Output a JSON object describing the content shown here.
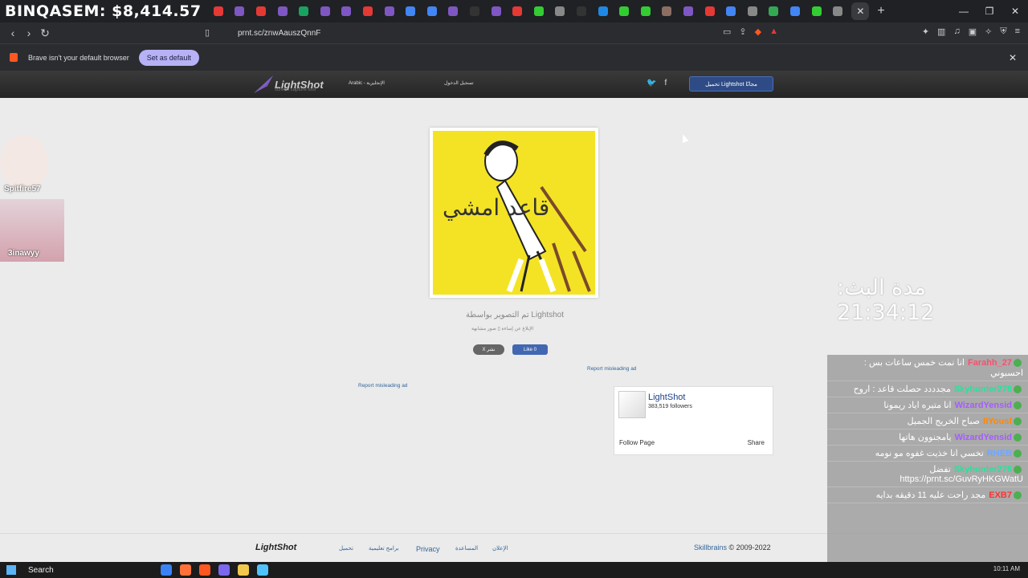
{
  "browser": {
    "tab_title": "BINQASEM: $8,414.57",
    "tab_icon_colors": [
      "#e53935",
      "#7e57c2",
      "#e53935",
      "#7e57c2",
      "#1aa260",
      "#7e57c2",
      "#7e57c2",
      "#e53935",
      "#7e57c2",
      "#4285f4",
      "#4285f4",
      "#7e57c2",
      "#333333",
      "#7e57c2",
      "#e53935",
      "#33cc33",
      "#888888",
      "#333333",
      "#1e88e5",
      "#33cc33",
      "#33cc33",
      "#8d6e63",
      "#7e57c2",
      "#e53935",
      "#4285f4",
      "#888888",
      "#34a853",
      "#4285f4",
      "#33cc33",
      "#888888"
    ],
    "active_tab_close": "✕",
    "new_tab": "+",
    "window_controls": [
      "—",
      "❐",
      "✕"
    ],
    "url": "prnt.sc/znwAauszQnnF",
    "nav_back": "‹",
    "nav_forward": "›",
    "reload": "↻",
    "infobar_text": "Brave isn't your default browser",
    "infobar_button": "Set as default",
    "infobar_close": "✕"
  },
  "lightshot_header": {
    "logo_text": "LightShot",
    "logo_sub": "screen capture tool",
    "language": "Arabic - الإنجليزية",
    "login": "تسجيل الدخول",
    "twitter": "🐦",
    "facebook": "f",
    "download_label": "تحميل Lightshot مجانًا"
  },
  "shot": {
    "captured_by": "تم التصوير بواسطة Lightshot",
    "report_links": "الإبلاغ عن إساءة  ▯  صور مشابهة",
    "x_button": "X نشر",
    "like_button": "Like 0",
    "misleading_left": "Report misleading ad",
    "misleading_right": "Report misleading ad",
    "image_caption": "قاعد امشي"
  },
  "fb_widget": {
    "name": "LightShot",
    "followers": "383,519 followers",
    "follow_label": "Follow Page",
    "share_label": "Share"
  },
  "footer": {
    "logo": "LightShot",
    "links": [
      "تحميل",
      "برامج تعليمية",
      "Privacy",
      "المساعدة",
      "الإعلان"
    ],
    "copyright_brand": "Skillbrains",
    "copyright_rest": " © 2009-2022"
  },
  "taskbar": {
    "search_label": "Search",
    "tray_text": "10:11 AM"
  },
  "stream": {
    "clock": "مدة البث: 21:34:12",
    "cam1_name": "Spitfire57",
    "cam2_name": "3inawyy",
    "chat": [
      {
        "user": "Farahh_27",
        "color": "#ff4d6d",
        "text": "انا نمت خمس ساعات بس : احسبوني"
      },
      {
        "user": "Skyhunter278",
        "color": "#27e29b",
        "text": "مجدددد حصلت قاعد : اروح"
      },
      {
        "user": "WizardYensid",
        "color": "#a55cff",
        "text": "انا متيره اياد ريمونا"
      },
      {
        "user": "IIYousf",
        "color": "#ff8800",
        "text": "صباح الخريج الجميل"
      },
      {
        "user": "WizardYensid",
        "color": "#a55cff",
        "text": "يامجنوون هاتها"
      },
      {
        "user": "RHEB",
        "color": "#6fa8ff",
        "text": "تخسي انا خذيت غفوه مو نومه"
      },
      {
        "user": "Skyhunter278",
        "color": "#27e29b",
        "text": "تفضل https://prnt.sc/GuvRyHKGWatU"
      },
      {
        "user": "EXB7",
        "color": "#ff3333",
        "text": "مجد راحت عليه 11 دقيقه بدايه"
      }
    ]
  }
}
